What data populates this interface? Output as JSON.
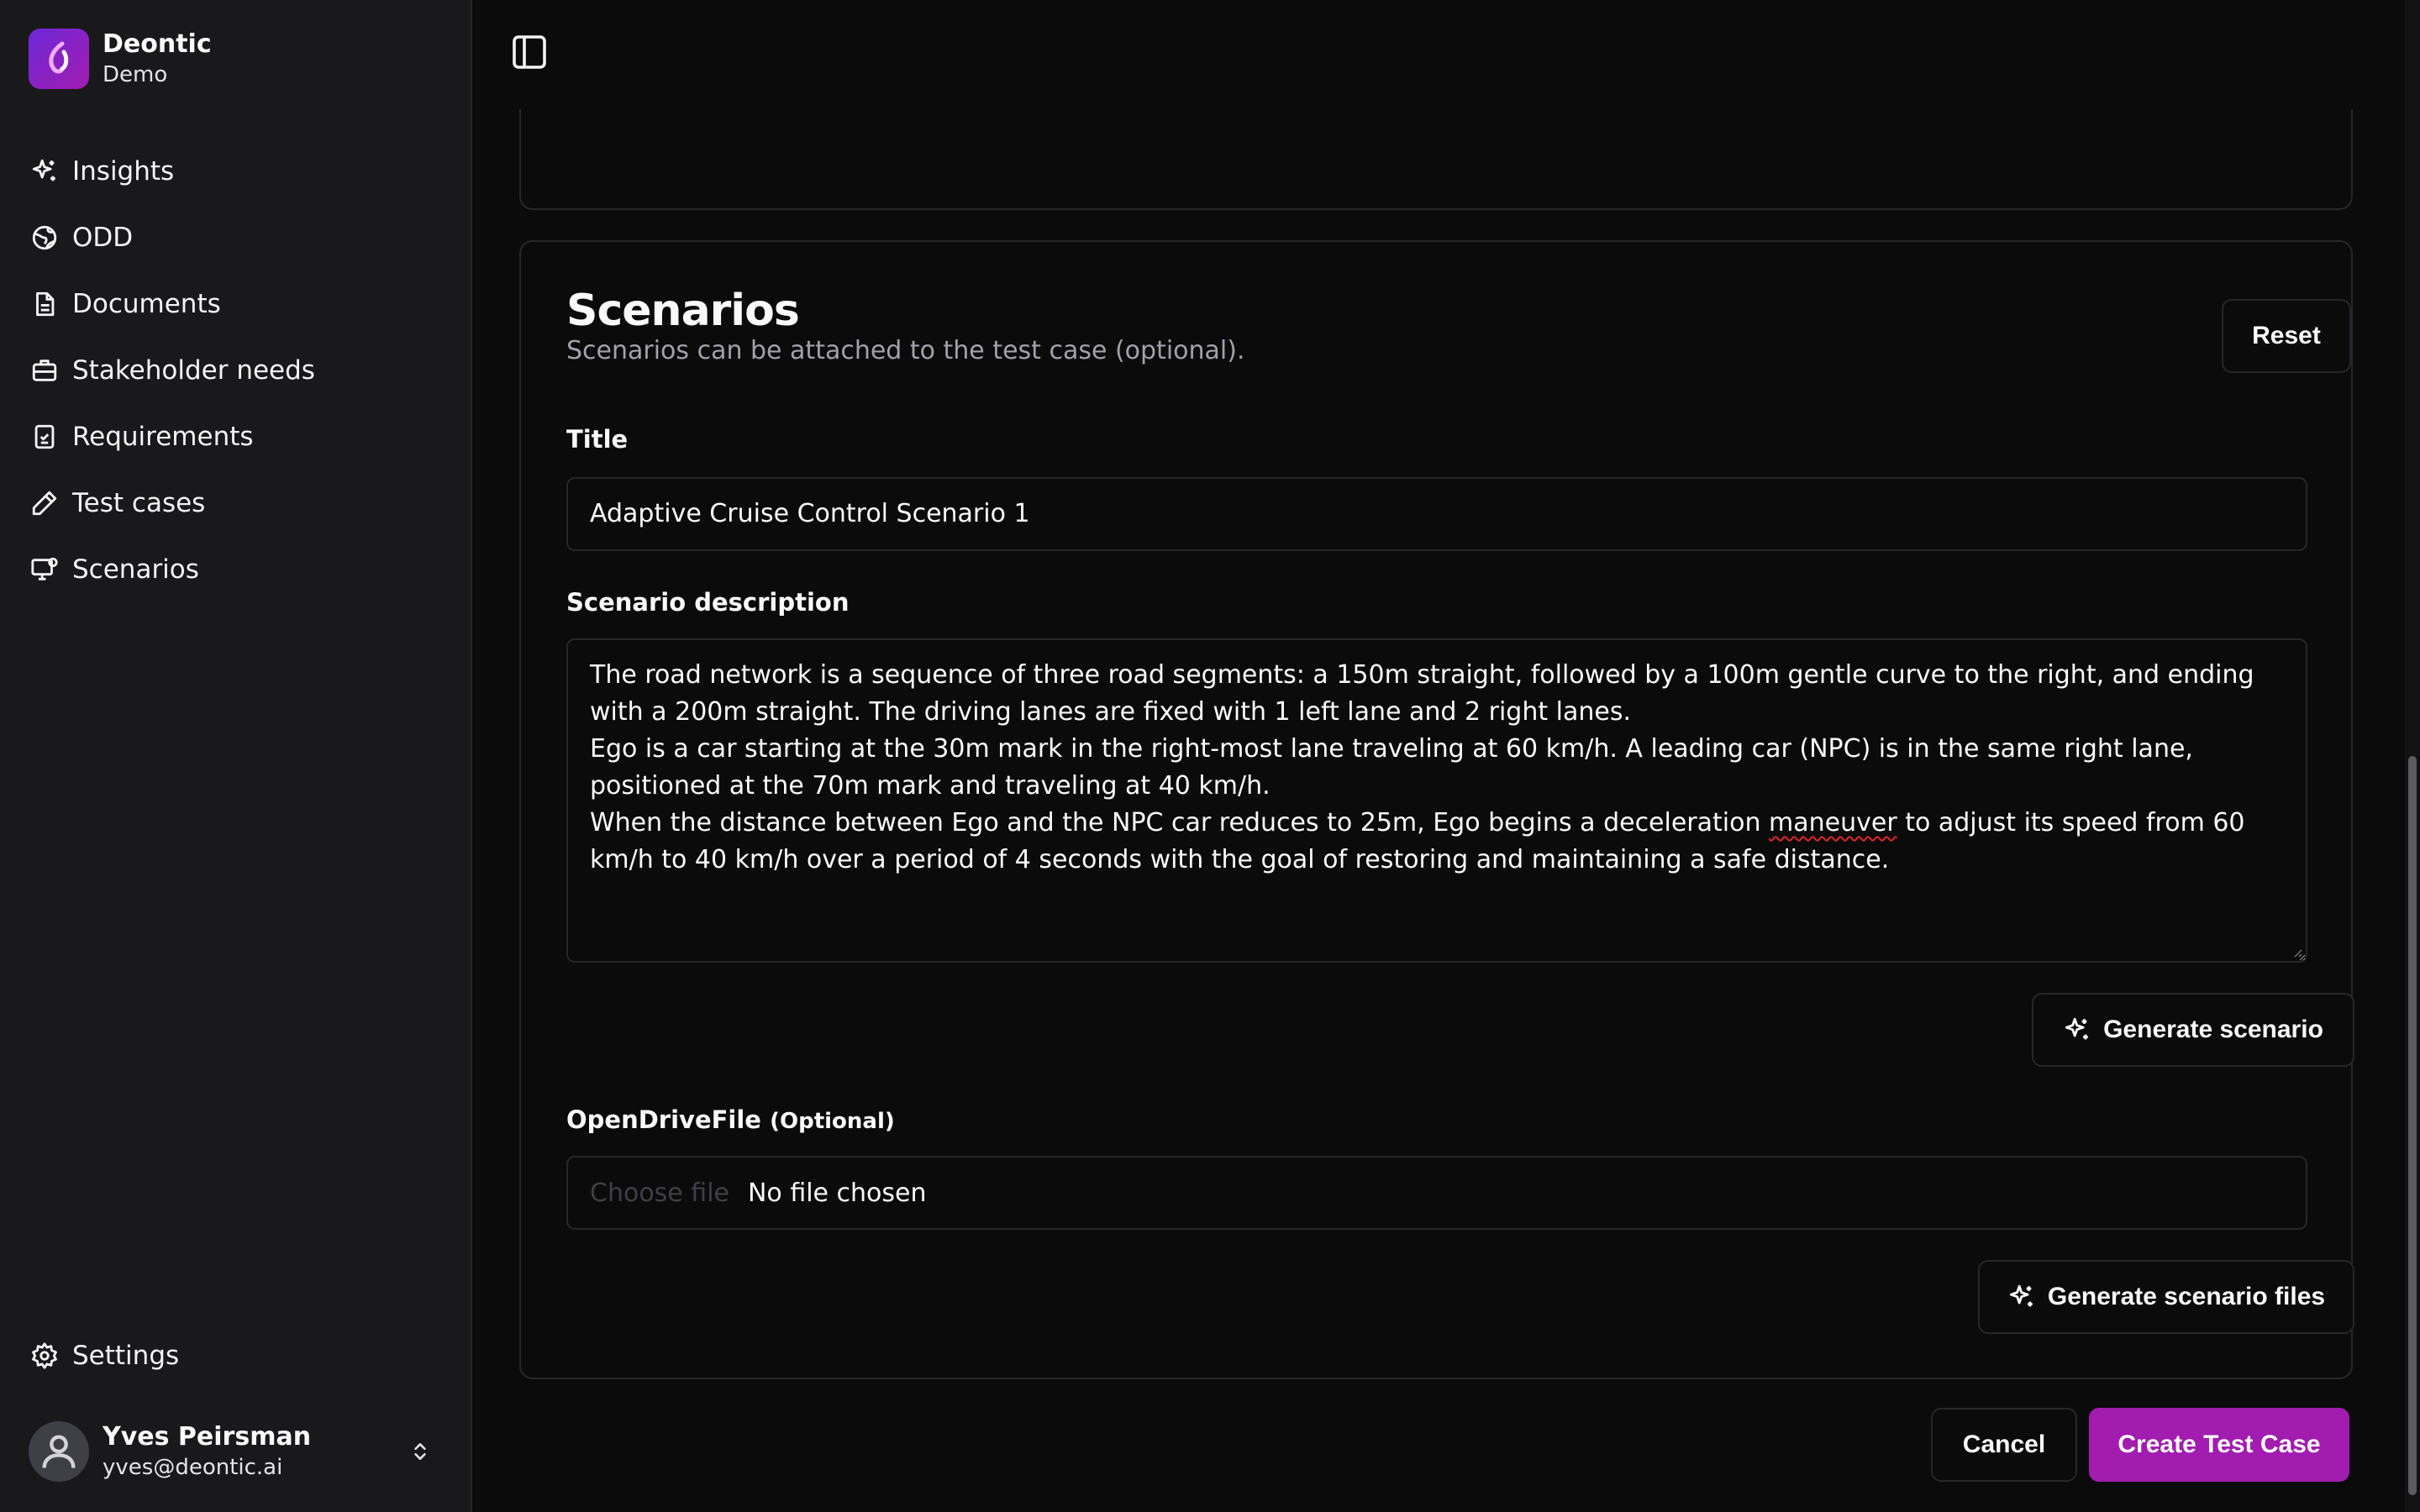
{
  "brand": {
    "name": "Deontic",
    "subtitle": "Demo"
  },
  "nav": {
    "items": [
      {
        "label": "Insights",
        "icon": "sparkles-icon"
      },
      {
        "label": "ODD",
        "icon": "globe-icon"
      },
      {
        "label": "Documents",
        "icon": "document-icon"
      },
      {
        "label": "Stakeholder needs",
        "icon": "briefcase-icon"
      },
      {
        "label": "Requirements",
        "icon": "checklist-icon"
      },
      {
        "label": "Test cases",
        "icon": "pencil-icon"
      },
      {
        "label": "Scenarios",
        "icon": "monitor-icon"
      }
    ],
    "settings_label": "Settings"
  },
  "user": {
    "name": "Yves Peirsman",
    "email": "yves@deontic.ai"
  },
  "scenarios": {
    "title": "Scenarios",
    "subtitle": "Scenarios can be attached to the test case (optional).",
    "reset_label": "Reset",
    "title_label": "Title",
    "title_value": "Adaptive Cruise Control Scenario 1",
    "description_label": "Scenario description",
    "description_before": "The road network is a sequence of three road segments: a 150m straight, followed by a 100m gentle curve to the right, and ending with a 200m straight. The driving lanes are fixed with 1 left lane and 2 right lanes.\nEgo is a car starting at the 30m mark in the right-most lane traveling at 60 km/h. A leading car (NPC) is in the same right lane, positioned at the 70m mark and traveling at 40 km/h.\nWhen the distance between Ego and the NPC car reduces to 25m, Ego begins a deceleration ",
    "description_misspelled": "maneuver",
    "description_after": " to adjust its speed from 60 km/h to 40 km/h over a period of 4 seconds with the goal of restoring and maintaining a safe distance.",
    "generate_label": "Generate scenario",
    "file_label": "OpenDriveFile",
    "file_optional": "(Optional)",
    "file_button": "Choose file",
    "file_status": "No file chosen",
    "generate_files_label": "Generate scenario files"
  },
  "footer": {
    "cancel_label": "Cancel",
    "create_label": "Create Test Case"
  },
  "colors": {
    "accent": "#a21caf",
    "background": "#0b0b0c",
    "sidebar": "#19191b",
    "border": "#27272a"
  }
}
